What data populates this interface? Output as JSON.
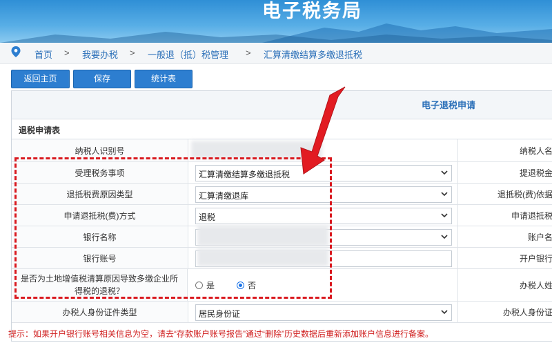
{
  "header": {
    "title": "电子税务局"
  },
  "breadcrumb": {
    "items": [
      "首页",
      "我要办税",
      "一般退（抵）税管理",
      "汇算清缴结算多缴退抵税"
    ],
    "separator": ">"
  },
  "toolbar": {
    "back": "返回主页",
    "save": "保存",
    "stats": "统计表"
  },
  "form": {
    "title": "电子退税申请",
    "section": "退税申请表",
    "rows": {
      "taxpayer_id": {
        "label": "纳税人识别号",
        "right": "纳税人名"
      },
      "tax_matter": {
        "label": "受理税务事项",
        "value": "汇算清缴结算多缴退抵税",
        "right": "提退税金"
      },
      "reason_type": {
        "label": "退抵税费原因类型",
        "value": "汇算清缴退库",
        "right": "退抵税(费)依据"
      },
      "method": {
        "label": "申请退抵税(费)方式",
        "value": "退税",
        "right": "申请退抵税"
      },
      "bank_name": {
        "label": "银行名称",
        "right": "账户名"
      },
      "bank_account": {
        "label": "银行账号",
        "right": "开户银行"
      },
      "land_tax": {
        "label": "是否为土地增值税清算原因导致多缴企业所得税的退税？",
        "options": [
          "是",
          "否"
        ],
        "selected": "否",
        "right": "办税人姓"
      },
      "id_type": {
        "label": "办税人身份证件类型",
        "value": "居民身份证",
        "right": "办税人身份证"
      }
    }
  },
  "hint": "提示：如果开户银行账号相关信息为空，请去“存款账户账号报告”通过“删除”历史数据后重新添加账户信息进行备案。",
  "colors": {
    "accent": "#2d7ed0",
    "annotation": "#d9181e",
    "hint": "#d02020"
  }
}
